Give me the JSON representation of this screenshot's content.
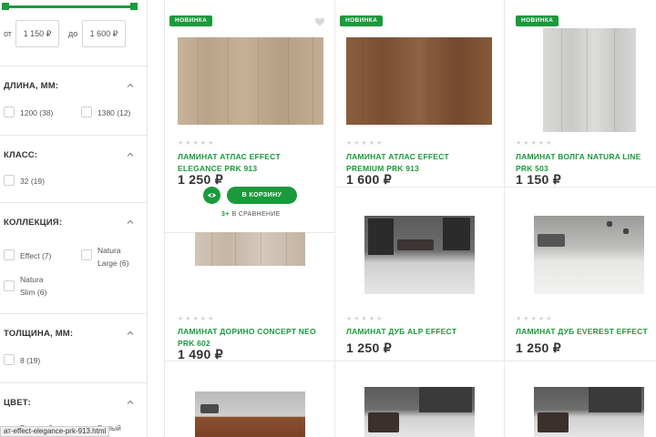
{
  "sidebar": {
    "price": {
      "from_label": "от",
      "from_value": "1 150 ₽",
      "to_label": "до",
      "to_value": "1 600 ₽"
    },
    "filters": [
      {
        "title": "ДЛИНА, ММ:",
        "options": [
          "1200 (38)",
          "1380 (12)"
        ]
      },
      {
        "title": "КЛАСС:",
        "options": [
          "32 (19)"
        ]
      },
      {
        "title": "КОЛЛЕКЦИЯ:",
        "options": [
          "Effect (7)",
          "Natura Large (6)",
          "Natura Slim (6)"
        ]
      },
      {
        "title": "ТОЛЩИНА, ММ:",
        "options": [
          "8 (19)"
        ]
      },
      {
        "title": "ЦВЕТ:",
        "options": [
          "Бежевый",
          "Белый"
        ]
      }
    ]
  },
  "status_bar": "ат-effect-elegance-prk-913.html",
  "products": [
    {
      "badge": "НОВИНКА",
      "stars": "★★★★★",
      "name": "ЛАМИНАТ АТЛАС EFFECT ELEGANCE PRK 913",
      "price": "1 250 ₽"
    },
    {
      "badge": "НОВИНКА",
      "stars": "★★★★★",
      "name": "ЛАМИНАТ АТЛАС EFFECT PREMIUM PRK 913",
      "price": "1 600 ₽"
    },
    {
      "badge": "НОВИНКА",
      "stars": "★★★★★",
      "name": "ЛАМИНАТ ВОЛГА NATURA LINE PRK 503",
      "price": "1 150 ₽"
    },
    {
      "stars": "★★★★★",
      "name": "ЛАМИНАТ ДОРИНО CONCEPT NEO PRK 602",
      "price": "1 490 ₽"
    },
    {
      "stars": "★★★★★",
      "name": "ЛАМИНАТ ДУБ ALP EFFECT",
      "price": "1 250 ₽"
    },
    {
      "stars": "★★★★★",
      "name": "ЛАМИНАТ ДУБ EVEREST EFFECT",
      "price": "1 250 ₽"
    }
  ],
  "card_actions": {
    "cart_label": "В КОРЗИНУ",
    "compare_plus": "3+",
    "compare_label": "В СРАВНЕНИЕ"
  },
  "colors": {
    "accent": "#1a9a3c"
  }
}
